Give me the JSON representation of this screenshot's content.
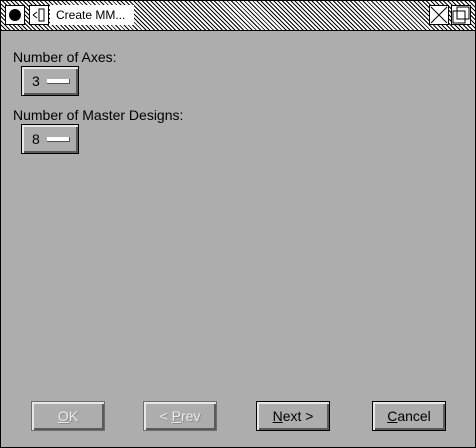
{
  "window": {
    "title": "Create MM...",
    "close_icon": "circle-close-icon",
    "menu_icon": "window-menu-icon",
    "iconify_icon": "iconify-x-icon",
    "maximize_icon": "maximize-icon"
  },
  "form": {
    "axes_label": "Number of Axes:",
    "axes_value": "3",
    "masters_label": "Number of Master Designs:",
    "masters_value": "8"
  },
  "buttons": {
    "ok": {
      "mnemonic": "O",
      "rest": "K",
      "enabled": false
    },
    "prev": {
      "pre": "< ",
      "mnemonic": "P",
      "rest": "rev",
      "enabled": false
    },
    "next": {
      "mnemonic": "N",
      "rest": "ext >",
      "enabled": true
    },
    "cancel": {
      "mnemonic": "C",
      "rest": "ancel",
      "enabled": true
    }
  }
}
